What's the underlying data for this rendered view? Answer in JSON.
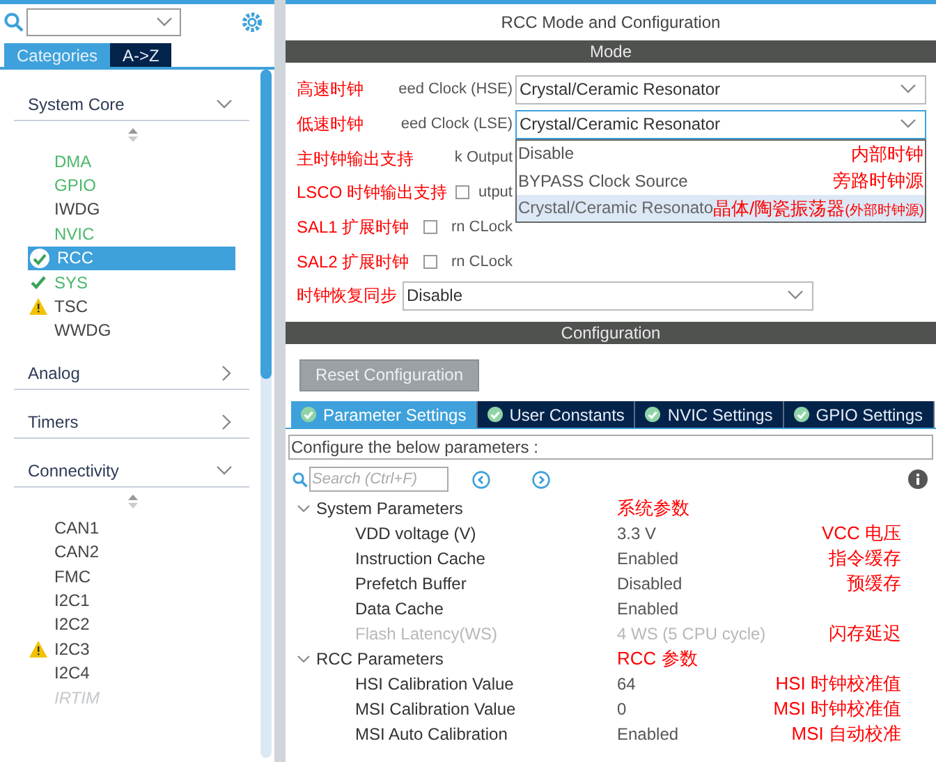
{
  "sidebar": {
    "tabs": [
      {
        "label": "Categories",
        "selected": true
      },
      {
        "label": "A->Z",
        "selected": false
      }
    ],
    "groups": [
      {
        "title": "System Core",
        "expanded": true,
        "items": [
          {
            "label": "DMA",
            "kind": "enabled",
            "selected": false
          },
          {
            "label": "GPIO",
            "kind": "enabled",
            "selected": false
          },
          {
            "label": "IWDG",
            "kind": "plain",
            "selected": false
          },
          {
            "label": "NVIC",
            "kind": "enabled",
            "selected": false
          },
          {
            "label": "RCC",
            "kind": "ok",
            "selected": true
          },
          {
            "label": "SYS",
            "kind": "ok",
            "selected": false
          },
          {
            "label": "TSC",
            "kind": "warning",
            "selected": false
          },
          {
            "label": "WWDG",
            "kind": "plain",
            "selected": false
          }
        ]
      },
      {
        "title": "Analog",
        "expanded": false
      },
      {
        "title": "Timers",
        "expanded": false
      },
      {
        "title": "Connectivity",
        "expanded": true,
        "items": [
          {
            "label": "CAN1",
            "kind": "plain",
            "selected": false
          },
          {
            "label": "CAN2",
            "kind": "plain",
            "selected": false
          },
          {
            "label": "FMC",
            "kind": "plain",
            "selected": false
          },
          {
            "label": "I2C1",
            "kind": "plain",
            "selected": false
          },
          {
            "label": "I2C2",
            "kind": "plain",
            "selected": false
          },
          {
            "label": "I2C3",
            "kind": "warning",
            "selected": false
          },
          {
            "label": "I2C4",
            "kind": "plain",
            "selected": false
          },
          {
            "label": "IRTIM",
            "kind": "disabled",
            "selected": false
          }
        ]
      }
    ]
  },
  "main": {
    "title": "RCC Mode and Configuration",
    "mode": {
      "header": "Mode",
      "rows": [
        {
          "kind": "select",
          "annotation": "高速时钟",
          "label": "eed Clock (HSE)",
          "value": "Crystal/Ceramic Resonator"
        },
        {
          "kind": "select",
          "annotation": "低速时钟",
          "label": "eed Clock (LSE)",
          "value": "Crystal/Ceramic Resonator",
          "open": true
        },
        {
          "kind": "label",
          "annotation": "主时钟输出支持",
          "label": "k Output"
        },
        {
          "kind": "checkbox",
          "annotation": "LSCO 时钟输出支持",
          "label": "utput",
          "checked": false
        },
        {
          "kind": "checkbox",
          "annotation": "SAL1 扩展时钟",
          "label": "rn CLock",
          "checked": false
        },
        {
          "kind": "checkbox",
          "annotation": "SAL2 扩展时钟",
          "label": "rn CLock",
          "checked": false
        },
        {
          "kind": "select",
          "annotation": "时钟恢复同步",
          "value": "Disable"
        }
      ],
      "dropdown": [
        {
          "label": "Disable",
          "annotation": "内部时钟",
          "selected": false
        },
        {
          "label": "BYPASS Clock Source",
          "annotation": "旁路时钟源",
          "selected": false
        },
        {
          "label": "Crystal/Ceramic Resonato",
          "annotation": "晶体/陶瓷振荡器",
          "note": "(外部时钟源)",
          "selected": true
        }
      ]
    },
    "configuration": {
      "header": "Configuration",
      "reset_button": "Reset Configuration",
      "tabs": [
        {
          "label": "Parameter Settings",
          "selected": true
        },
        {
          "label": "User Constants",
          "selected": false
        },
        {
          "label": "NVIC Settings",
          "selected": false
        },
        {
          "label": "GPIO Settings",
          "selected": false
        }
      ],
      "caption": "Configure the below parameters :",
      "search": {
        "placeholder": "Search (Ctrl+F)"
      },
      "sections": [
        {
          "title": "System Parameters",
          "annotation": "系统参数",
          "expanded": true,
          "rows": [
            {
              "name": "VDD voltage (V)",
              "value": "3.3 V",
              "annotation": "VCC 电压",
              "disabled": false
            },
            {
              "name": "Instruction Cache",
              "value": "Enabled",
              "annotation": "指令缓存",
              "disabled": false
            },
            {
              "name": "Prefetch Buffer",
              "value": "Disabled",
              "annotation": "预缓存",
              "disabled": false
            },
            {
              "name": "Data Cache",
              "value": "Enabled",
              "disabled": false
            },
            {
              "name": "Flash Latency(WS)",
              "value": "4 WS (5 CPU cycle)",
              "annotation": "闪存延迟",
              "disabled": true
            }
          ]
        },
        {
          "title": "RCC Parameters",
          "annotation": "RCC 参数",
          "expanded": true,
          "rows": [
            {
              "name": "HSI Calibration Value",
              "value": "64",
              "annotation": "HSI 时钟校准值",
              "disabled": false
            },
            {
              "name": "MSI Calibration Value",
              "value": "0",
              "annotation": "MSI 时钟校准值",
              "disabled": false
            },
            {
              "name": "MSI Auto Calibration",
              "value": "Enabled",
              "annotation": "MSI 自动校准",
              "disabled": false
            }
          ]
        }
      ]
    }
  }
}
